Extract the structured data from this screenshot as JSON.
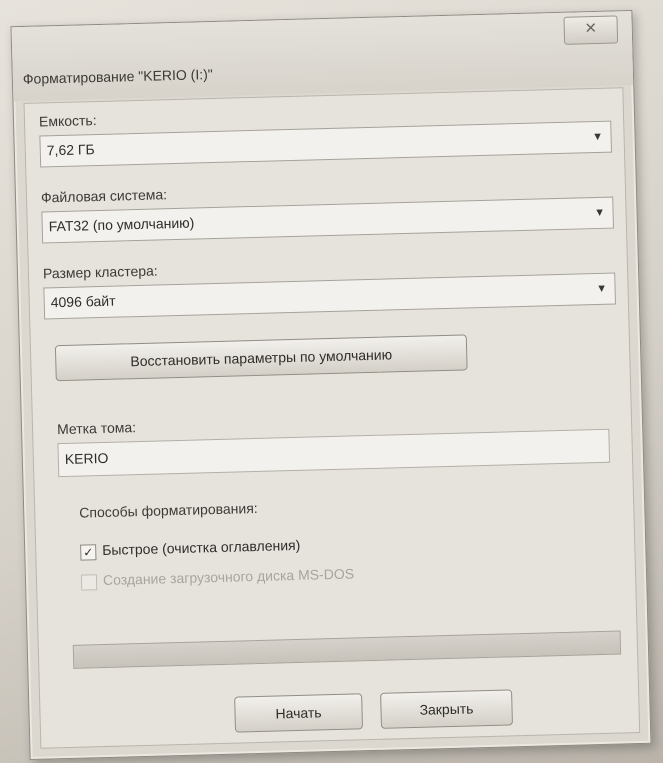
{
  "dialog": {
    "title": "Форматирование \"KERIO (I:)\"",
    "close_glyph": "✕"
  },
  "capacity": {
    "label": "Емкость:",
    "value": "7,62 ГБ"
  },
  "filesystem": {
    "label": "Файловая система:",
    "value": "FAT32 (по умолчанию)"
  },
  "cluster": {
    "label": "Размер кластера:",
    "value": "4096 байт"
  },
  "restore_defaults_label": "Восстановить параметры по умолчанию",
  "volume_label": {
    "label": "Метка тома:",
    "value": "KERIO"
  },
  "format_options": {
    "label": "Способы форматирования:",
    "quick": {
      "label": "Быстрое (очистка оглавления)",
      "checked": true
    },
    "msdos": {
      "label": "Создание загрузочного диска MS-DOS",
      "checked": false,
      "enabled": false
    }
  },
  "progress": {
    "value": 0
  },
  "buttons": {
    "start": "Начать",
    "close": "Закрыть"
  },
  "icons": {
    "dropdown": "▼",
    "check": "✓"
  }
}
